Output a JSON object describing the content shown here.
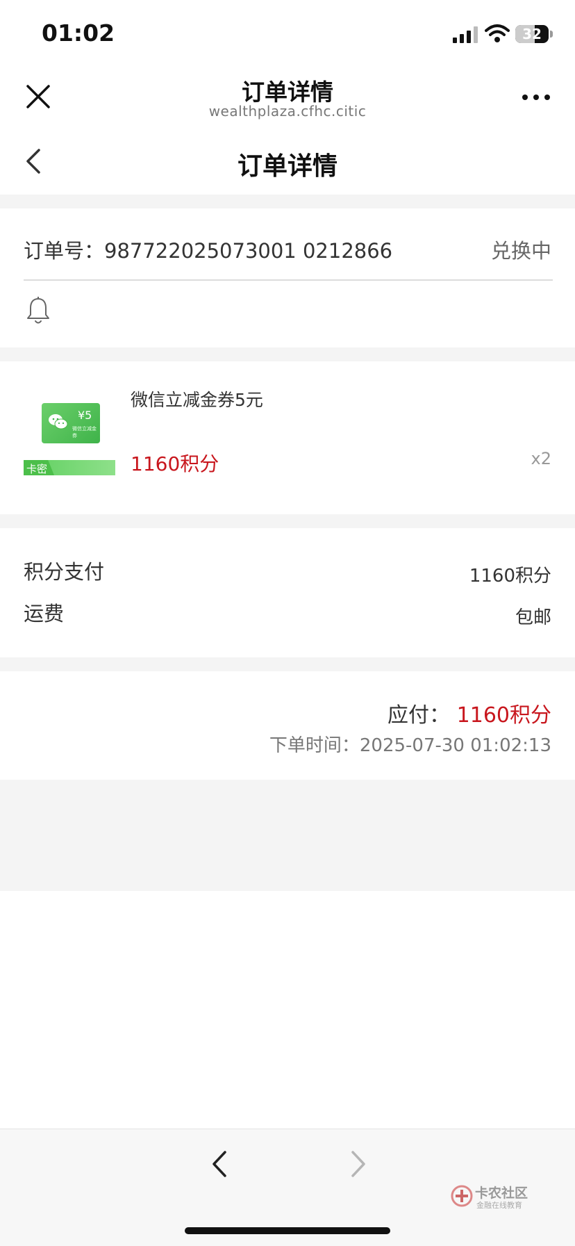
{
  "status_bar": {
    "time": "01:02",
    "battery": "32"
  },
  "webview": {
    "title": "订单详情",
    "domain": "wealthplaza.cfhc.citic"
  },
  "page": {
    "title": "订单详情"
  },
  "order": {
    "number_text": "订单号：987722025073001 0212866",
    "status": "兑换中"
  },
  "product": {
    "name": "微信立减金券5元",
    "price": "1160积分",
    "quantity": "x2",
    "tag": "卡密",
    "card_value": "¥5",
    "card_subtitle": "微信立减金券"
  },
  "payment": {
    "points_label": "积分支付",
    "points_value": "1160积分",
    "shipping_label": "运费",
    "shipping_value": "包邮"
  },
  "total": {
    "due_label": "应付：",
    "due_value": "1160积分",
    "order_time": "下单时间：2025-07-30 01:02:13"
  },
  "watermark": {
    "title": "卡农社区",
    "subtitle": "金融在线教育"
  },
  "colors": {
    "price_red": "#c8161d",
    "wechat_green": "#3fb34a",
    "gap_gray": "#f4f4f4"
  }
}
